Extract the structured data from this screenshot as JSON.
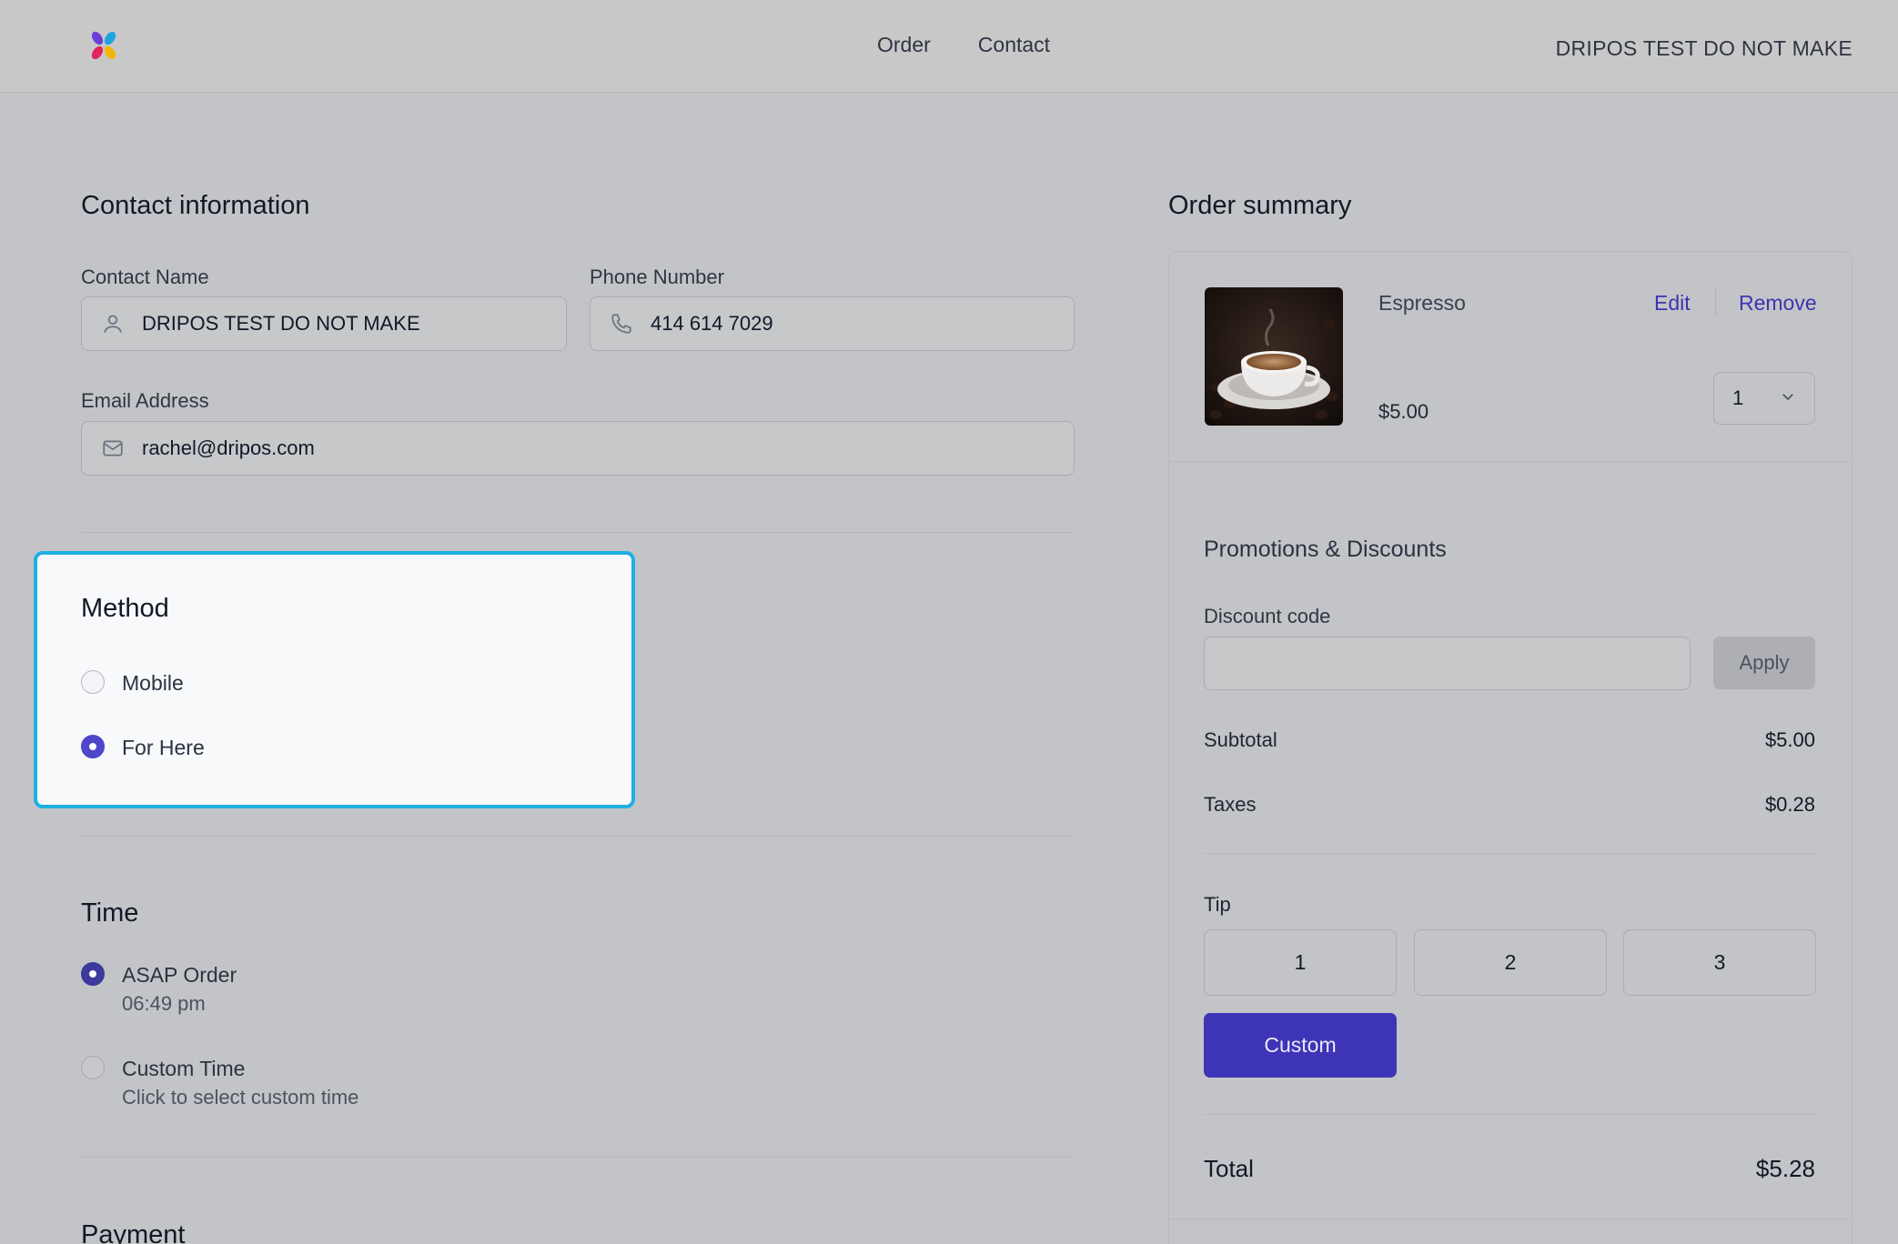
{
  "header": {
    "nav": [
      "Order",
      "Contact"
    ],
    "store_name": "DRIPOS TEST DO NOT MAKE"
  },
  "contact": {
    "title": "Contact information",
    "name_label": "Contact Name",
    "name_value": "DRIPOS TEST DO NOT MAKE",
    "phone_label": "Phone Number",
    "phone_value": "414 614 7029",
    "email_label": "Email Address",
    "email_value": "rachel@dripos.com"
  },
  "method": {
    "title": "Method",
    "options": [
      {
        "label": "Mobile",
        "selected": false
      },
      {
        "label": "For Here",
        "selected": true
      }
    ]
  },
  "time": {
    "title": "Time",
    "options": [
      {
        "label": "ASAP Order",
        "sub": "06:49 pm",
        "selected": true
      },
      {
        "label": "Custom Time",
        "sub": "Click to select custom time",
        "selected": false
      }
    ]
  },
  "payment": {
    "title": "Payment"
  },
  "summary": {
    "title": "Order summary",
    "item": {
      "name": "Espresso",
      "price": "$5.00",
      "edit_label": "Edit",
      "remove_label": "Remove",
      "quantity": "1"
    },
    "promotions_title": "Promotions & Discounts",
    "discount_label": "Discount code",
    "discount_placeholder": "",
    "apply_label": "Apply",
    "subtotal_label": "Subtotal",
    "subtotal_value": "$5.00",
    "taxes_label": "Taxes",
    "taxes_value": "$0.28",
    "tip_label": "Tip",
    "tip_options": [
      "1",
      "2",
      "3"
    ],
    "custom_label": "Custom",
    "total_label": "Total",
    "total_value": "$5.28"
  },
  "colors": {
    "accent": "#3e35b6",
    "highlight_border": "#1fb0e3"
  }
}
